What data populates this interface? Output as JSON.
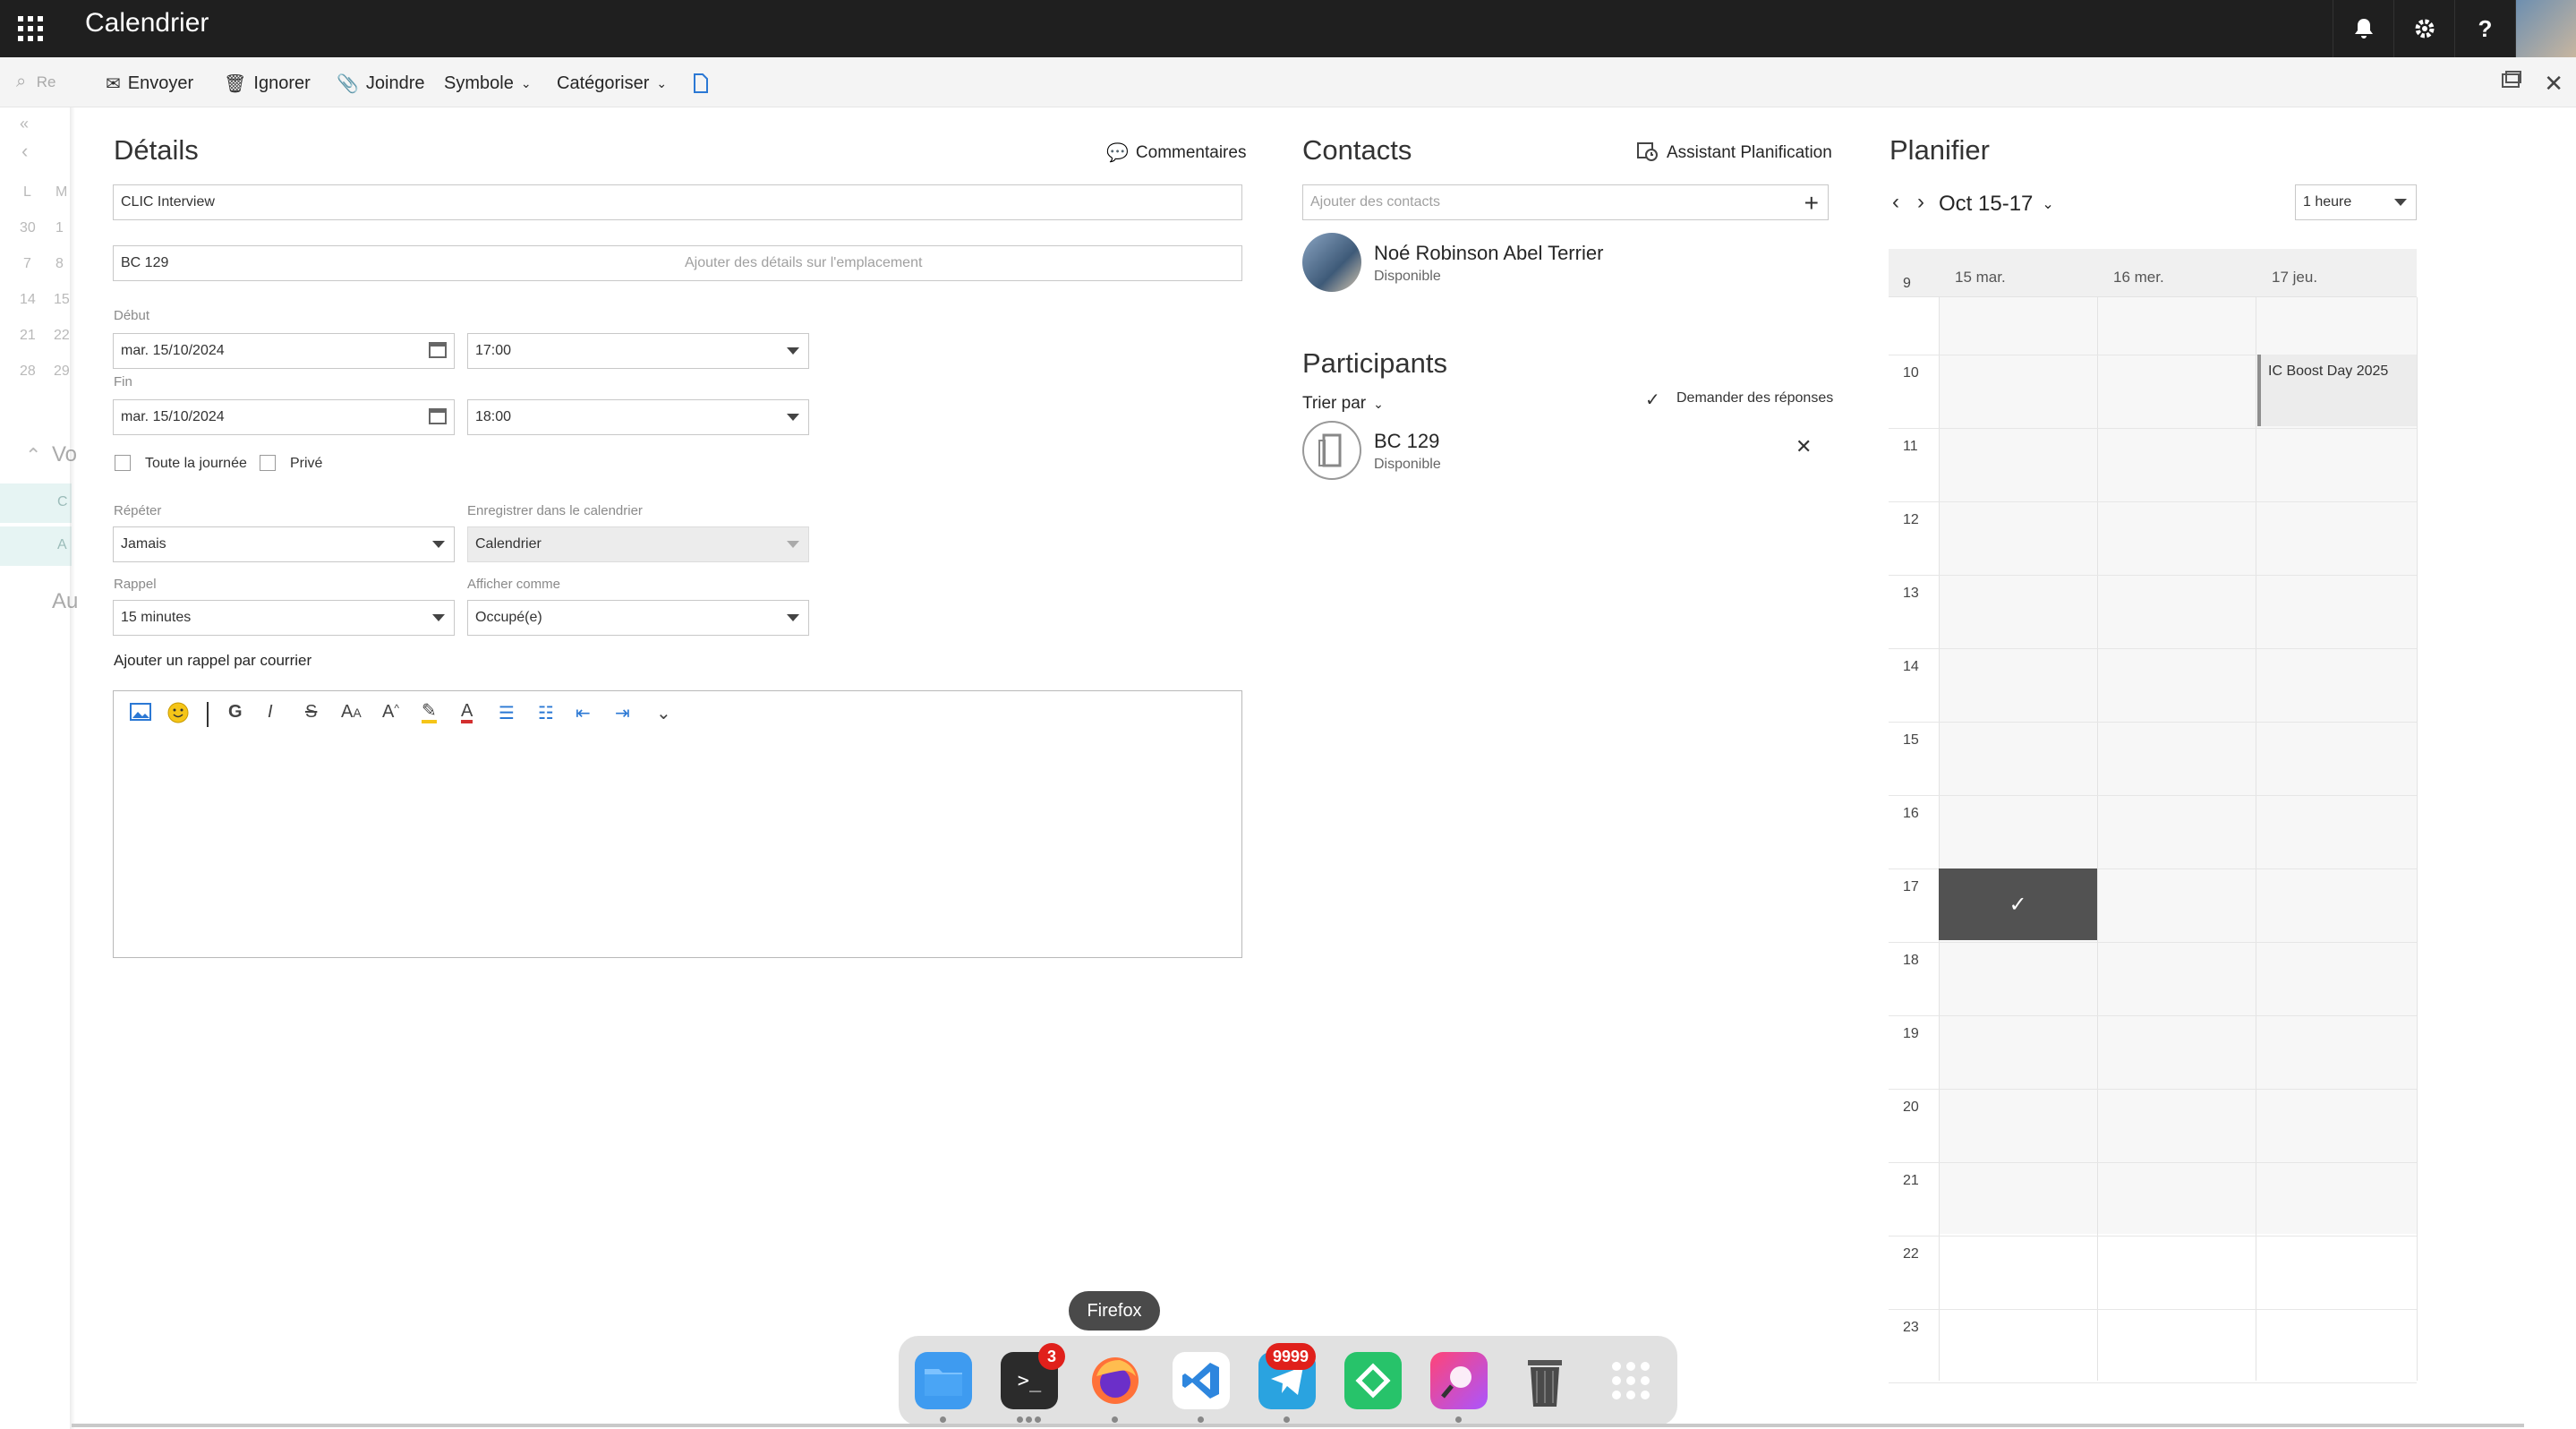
{
  "topbar": {
    "title": "Calendrier",
    "notifications_icon": "bell-icon",
    "settings_icon": "gear-icon",
    "help_label": "?"
  },
  "toolbar": {
    "search_placeholder": "Re",
    "send": "Envoyer",
    "ignore": "Ignorer",
    "attach": "Joindre",
    "symbol": "Symbole",
    "categorize": "Catégoriser"
  },
  "leftnav": {
    "days": [
      "L",
      "M"
    ],
    "rows": [
      [
        "30",
        "1"
      ],
      [
        "7",
        "8"
      ],
      [
        "14",
        "15"
      ],
      [
        "21",
        "22"
      ],
      [
        "28",
        "29"
      ]
    ],
    "section": "Vo",
    "item1": "C",
    "item2": "A",
    "item3": "Au"
  },
  "details": {
    "title": "Détails",
    "comments": "Commentaires",
    "subject": "CLIC Interview",
    "location": "BC 129",
    "location_hint": "Ajouter des détails sur l'emplacement",
    "start_label": "Début",
    "start_date": "mar. 15/10/2024",
    "start_time": "17:00",
    "end_label": "Fin",
    "end_date": "mar. 15/10/2024",
    "end_time": "18:00",
    "all_day": "Toute la journée",
    "private": "Privé",
    "repeat_label": "Répéter",
    "repeat_value": "Jamais",
    "save_cal_label": "Enregistrer dans le calendrier",
    "save_cal_value": "Calendrier",
    "reminder_label": "Rappel",
    "reminder_value": "15 minutes",
    "show_as_label": "Afficher comme",
    "show_as_value": "Occupé(e)",
    "email_reminder": "Ajouter un rappel par courrier"
  },
  "contacts": {
    "title": "Contacts",
    "scheduling": "Assistant Planification",
    "add_placeholder": "Ajouter des contacts",
    "person_name": "Noé Robinson Abel Terrier",
    "person_status": "Disponible"
  },
  "participants": {
    "title": "Participants",
    "sort": "Trier par",
    "request_responses": "Demander des réponses",
    "room_name": "BC 129",
    "room_status": "Disponible"
  },
  "planner": {
    "title": "Planifier",
    "range": "Oct 15-17",
    "interval": "1 heure",
    "days": [
      "15 mar.",
      "16 mer.",
      "17 jeu."
    ],
    "hours": [
      "9",
      "10",
      "11",
      "12",
      "13",
      "14",
      "15",
      "16",
      "17",
      "18",
      "19",
      "20",
      "21",
      "22",
      "23"
    ],
    "event": "IC Boost Day 2025"
  },
  "dock": {
    "tooltip": "Firefox",
    "terminal_badge": "3",
    "telegram_badge": "9999"
  },
  "colors": {
    "topbar": "#1f1f1f",
    "selected_slot": "#525252",
    "badge": "#e0201b"
  }
}
